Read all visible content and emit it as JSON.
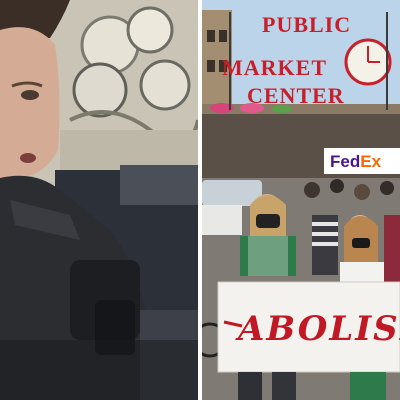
{
  "collage": {
    "left_photo": {
      "subject": "officer-in-vehicle"
    },
    "right_photo": {
      "market_sign": {
        "line1": "PUBLIC",
        "line2": "MARKET",
        "line3": "CENTER"
      },
      "store_sign": {
        "fed": "Fed",
        "ex": "Ex"
      },
      "protest_banner": {
        "text": "ABOLISH"
      }
    },
    "colors": {
      "sign_red": "#c8202a",
      "banner_red": "#c01824",
      "apron_green": "#2f7a4a",
      "fedex_purple": "#4d148c",
      "fedex_orange": "#ff6600"
    }
  }
}
